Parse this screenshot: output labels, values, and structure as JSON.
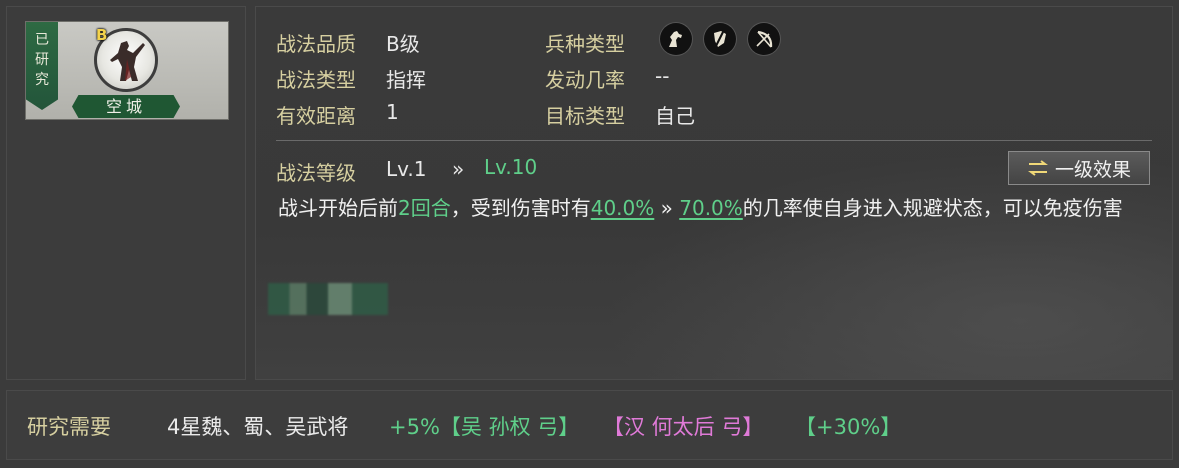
{
  "skill_card": {
    "research_status_chars": [
      "已",
      "研",
      "究"
    ],
    "grade": "B",
    "name": "空城"
  },
  "attributes": {
    "quality_label": "战法品质",
    "quality_value": "B级",
    "type_label": "战法类型",
    "type_value": "指挥",
    "range_label": "有效距离",
    "range_value": "1",
    "troop_label": "兵种类型",
    "troop_icons": [
      "cavalry-horse-icon",
      "shield-infantry-icon",
      "bow-archer-icon"
    ],
    "rate_label": "发动几率",
    "rate_value": "--",
    "target_label": "目标类型",
    "target_value": "自己"
  },
  "level": {
    "label": "战法等级",
    "current": "Lv.1",
    "arrow": "»",
    "max": "Lv.10",
    "effect_button": "一级效果"
  },
  "description": {
    "part1": "战斗开始后前",
    "rounds": "2回合",
    "part2": "，受到伤害时有",
    "chance_low": "40.0%",
    "arrow": "»",
    "chance_high": "70.0%",
    "part3": "的几率使自身进入规避状态，可以免疫伤害"
  },
  "requirement": {
    "label": "研究需要",
    "text": "4星魏、蜀、吴武将",
    "bonus": "+5%【吴 孙权 弓】",
    "general2": "【汉 何太后 弓】",
    "bonus2": "【+30%】"
  },
  "colors": {
    "label_gold": "#d6cfa0",
    "highlight_green": "#5fcf8a",
    "general_pink": "#e07ad8",
    "ribbon_green": "#1f5733"
  }
}
